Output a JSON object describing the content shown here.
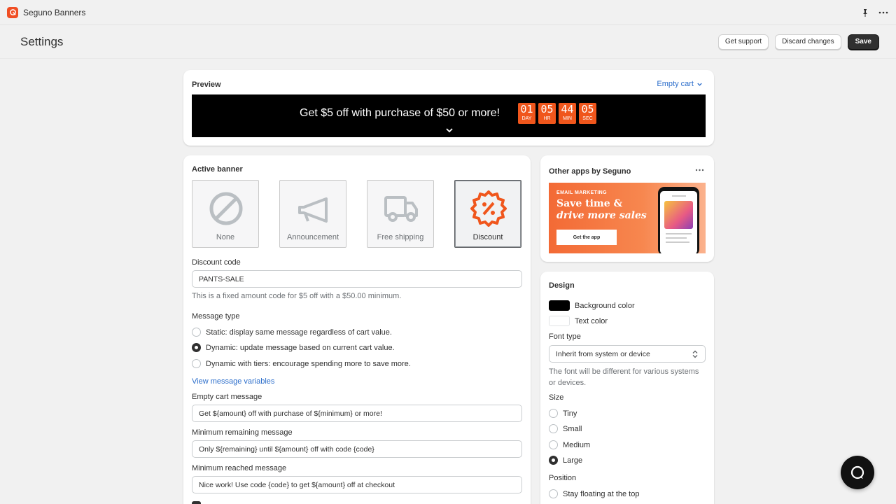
{
  "app": {
    "title": "Seguno Banners"
  },
  "header": {
    "title": "Settings",
    "get_support": "Get support",
    "discard": "Discard changes",
    "save": "Save"
  },
  "preview": {
    "title": "Preview",
    "select_value": "Empty cart",
    "banner_text": "Get $5 off with purchase of $50 or more!",
    "countdown": [
      {
        "value": "01",
        "label": "DAY"
      },
      {
        "value": "05",
        "label": "HR"
      },
      {
        "value": "44",
        "label": "MIN"
      },
      {
        "value": "05",
        "label": "SEC"
      }
    ],
    "banner_bg": "#000000",
    "accent": "#f0561c"
  },
  "active_banner": {
    "title": "Active banner",
    "options": [
      {
        "label": "None",
        "icon": "prohibited-icon"
      },
      {
        "label": "Announcement",
        "icon": "megaphone-icon"
      },
      {
        "label": "Free shipping",
        "icon": "truck-icon"
      },
      {
        "label": "Discount",
        "icon": "discount-badge-icon",
        "selected": true
      }
    ]
  },
  "discount": {
    "label": "Discount code",
    "value": "PANTS-SALE",
    "help": "This is a fixed amount code for $5 off with a $50.00 minimum."
  },
  "message_type": {
    "label": "Message type",
    "options": [
      {
        "label": "Static: display same message regardless of cart value.",
        "checked": false
      },
      {
        "label": "Dynamic: update message based on current cart value.",
        "checked": true
      },
      {
        "label": "Dynamic with tiers: encourage spending more to save more.",
        "checked": false
      }
    ],
    "link": "View message variables"
  },
  "messages": {
    "empty_label": "Empty cart message",
    "empty_value": "Get ${amount} off with purchase of ${minimum} or more!",
    "remaining_label": "Minimum remaining message",
    "remaining_value": "Only ${remaining} until ${amount} off with code {code}",
    "reached_label": "Minimum reached message",
    "reached_value": "Nice work! Use code {code} to get ${amount} off at checkout"
  },
  "other_apps": {
    "title": "Other apps by Seguno",
    "promo_kicker": "EMAIL MARKETING",
    "promo_head_1": "Save time &",
    "promo_head_2": "drive more sales",
    "promo_cta": "Get the app"
  },
  "design": {
    "title": "Design",
    "bg_label": "Background color",
    "bg_color": "#000000",
    "text_label": "Text color",
    "text_color": "#ffffff",
    "font_label": "Font type",
    "font_value": "Inherit from system or device",
    "font_help": "The font will be different for various systems or devices.",
    "size_label": "Size",
    "sizes": [
      {
        "label": "Tiny",
        "checked": false
      },
      {
        "label": "Small",
        "checked": false
      },
      {
        "label": "Medium",
        "checked": false
      },
      {
        "label": "Large",
        "checked": true
      }
    ],
    "position_label": "Position",
    "position_option": "Stay floating at the top"
  }
}
